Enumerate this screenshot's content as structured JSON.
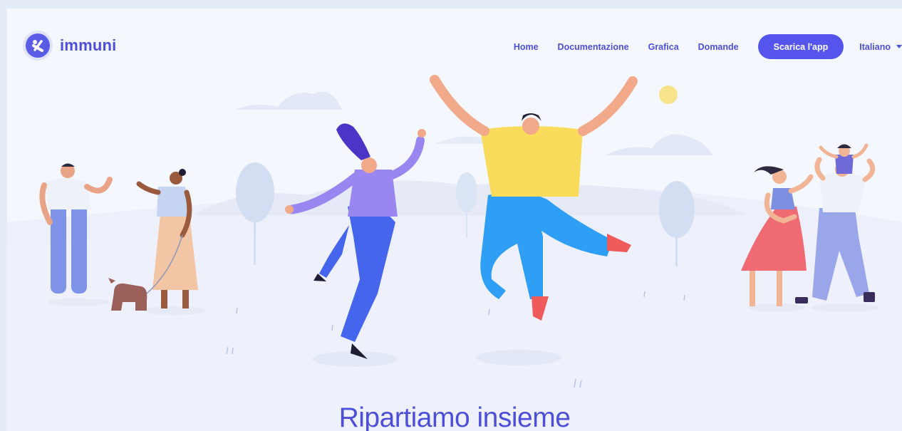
{
  "brand": {
    "name": "immuni",
    "logo_icon": "immuni-logo-icon"
  },
  "nav": {
    "links": [
      {
        "label": "Home"
      },
      {
        "label": "Documentazione"
      },
      {
        "label": "Grafica"
      },
      {
        "label": "Domande"
      }
    ],
    "cta_label": "Scarica l'app",
    "language": "Italiano"
  },
  "hero": {
    "headline": "Ripartiamo insieme"
  },
  "colors": {
    "accent": "#5555ee",
    "text_brand": "#4d4fd9",
    "background": "#f4f7fd"
  }
}
